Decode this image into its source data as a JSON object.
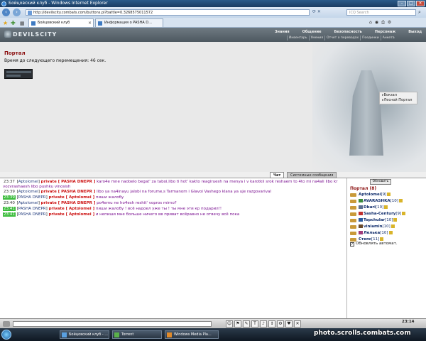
{
  "browser": {
    "title": "Бойцовский клуб - Windows Internet Explorer",
    "url": "http://devilscity.combats.com/buttons.pl?battle=0.3268575011572",
    "search_placeholder": "ICQ Search",
    "tabs": [
      {
        "label": "Бойцовский клуб"
      },
      {
        "label": "Информация о PASHA D..."
      }
    ]
  },
  "site": {
    "logo": "DEVILSCITY",
    "nav": [
      "Знания",
      "Общение",
      "Безопасность",
      "Персонаж",
      "Выход"
    ],
    "subnav": [
      "Инвентарь",
      "Умения",
      "Отчет о переводах",
      "Поединки",
      "Анкета"
    ]
  },
  "location": {
    "title": "Портал",
    "timer_text": "Время до следующего перемещения: 46 сек.",
    "exits": [
      "Вокзал",
      "Лесной Портал"
    ]
  },
  "chat": {
    "tabs": [
      "Чат",
      "Системные сообщения"
    ],
    "messages": [
      {
        "time": "23:37",
        "time_highlight": false,
        "from": "Aptolomei",
        "to": "PASHA DNEPR",
        "text": "karo4e mne nadoelo begat' za taboi,libo ti hot' kakto reagiruesh na menya i v karotkii srok reshaem to 4to mi na4ali libo kr vozvrashaesh libo pushku vinosish"
      },
      {
        "time": "23:39",
        "time_highlight": false,
        "from": "Aptolomei",
        "to": "PASHA DNEPR",
        "text": "libo ya na4inayu jalobi na forume,s Tarmanom i Glavoi Vashego klana ya uje razgovarival"
      },
      {
        "time": "23:39",
        "time_highlight": true,
        "from": "PASHA DNEPR",
        "to": "Aptolomei",
        "text": "пиши жалобу"
      },
      {
        "time": "23:40",
        "time_highlight": false,
        "from": "Aptolomei",
        "to": "PASHA DNEPR",
        "text": "po4emu ne ho4esh reshit' vopros mirno?"
      },
      {
        "time": "23:41",
        "time_highlight": true,
        "from": "PASHA DNEPR",
        "to": "Aptolomei",
        "text": "пиши жалобу ! всё надоел уже ты ! ты мне эти кр подарил!!"
      },
      {
        "time": "23:41",
        "time_highlight": true,
        "from": "PASHA DNEPR",
        "to": "Aptolomei",
        "text": "и непиши мне больше ничего вв приват всёравно не отвечу всё пока"
      }
    ],
    "private_prefix": "private [",
    "private_suffix": "]"
  },
  "room": {
    "refresh_label": "Обновить",
    "title": "Портал (8)",
    "players": [
      {
        "name": "Aptolomei",
        "level": "[9]"
      },
      {
        "name": "AVARASHKA",
        "level": "[10]"
      },
      {
        "name": "Dburi",
        "level": "[10]"
      },
      {
        "name": "Sasha-Century",
        "level": "[9]"
      },
      {
        "name": "Topchular",
        "level": "[10]"
      },
      {
        "name": "viniamin",
        "level": "[10]"
      },
      {
        "name": "Лелька",
        "level": "[10]"
      },
      {
        "name": "Степс",
        "level": "[11]"
      }
    ],
    "auto_refresh_label": "Обновлять автомат."
  },
  "toolbar": {
    "clock": "23:14"
  },
  "taskbar": {
    "items": [
      "Бойцовский клуб - ...",
      "Torrent",
      "Windows Media Pla..."
    ]
  },
  "watermark": "photo.scrolls.combats.com",
  "colors": {
    "private": "#cc1010",
    "highlight_time": "#3dbd3d",
    "location_title": "#8b1010"
  }
}
